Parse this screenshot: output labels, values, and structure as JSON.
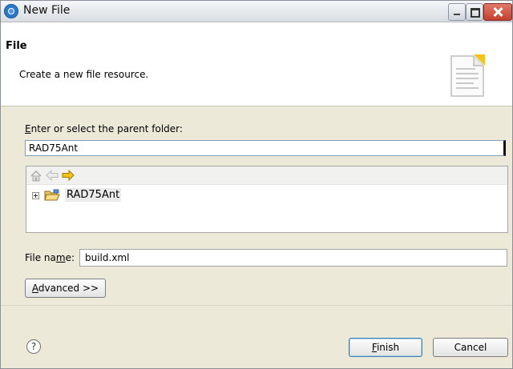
{
  "window": {
    "title": "New File"
  },
  "banner": {
    "title": "File",
    "description": "Create a new file resource."
  },
  "parent_folder": {
    "label_accel": "E",
    "label_rest": "nter or select the parent folder:",
    "value": "RAD75Ant"
  },
  "tree": {
    "items": [
      {
        "label": "RAD75Ant",
        "expanded": false,
        "selected": true
      }
    ]
  },
  "file_name": {
    "label_before": "File na",
    "label_accel": "m",
    "label_after": "e:",
    "value": "build.xml"
  },
  "buttons": {
    "advanced_accel": "A",
    "advanced_rest": "dvanced >>",
    "finish_accel": "F",
    "finish_rest": "inish",
    "cancel": "Cancel"
  },
  "help": {
    "glyph": "?"
  },
  "icons": {
    "app": "eclipse-circle-icon",
    "banner": "new-file-page-icon",
    "toolbar": [
      "home-icon",
      "back-arrow-icon",
      "forward-arrow-icon"
    ],
    "tree_item": "open-folder-icon"
  },
  "colors": {
    "accent_arrow": "#f3c317",
    "selection": "#ebebeb",
    "close_button": "#c4402f"
  }
}
